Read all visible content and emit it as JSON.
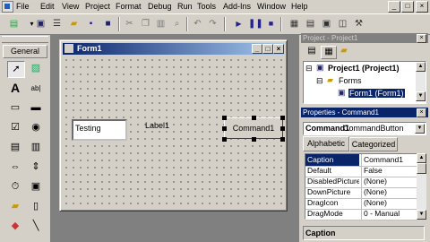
{
  "menu": {
    "items": [
      "File",
      "Edit",
      "View",
      "Project",
      "Format",
      "Debug",
      "Run",
      "Tools",
      "Add-Ins",
      "Window",
      "Help"
    ],
    "window_controls": [
      "_",
      "□",
      "×"
    ]
  },
  "toolbar": {
    "icons": [
      "add-project-icon",
      "add-form-icon",
      "menu-editor-icon",
      "open-icon",
      "save-icon",
      "cut-icon",
      "copy-icon",
      "paste-icon",
      "find-icon",
      "undo-icon",
      "redo-icon",
      "start-icon",
      "break-icon",
      "end-icon",
      "project-explorer-icon",
      "properties-window-icon",
      "form-layout-icon",
      "object-browser-icon",
      "toolbox-icon"
    ]
  },
  "toolbox": {
    "tab_label": "General",
    "tools": [
      "pointer",
      "picturebox",
      "label",
      "textbox",
      "frame",
      "commandbutton",
      "checkbox",
      "optionbutton",
      "combobox",
      "listbox",
      "hscrollbar",
      "vscrollbar",
      "timer",
      "drivelistbox",
      "dirlistbox",
      "filelistbox",
      "shape",
      "line"
    ]
  },
  "form": {
    "title": "Form1",
    "textbox_value": "Testing",
    "label_caption": "Label1",
    "button_caption": "Command1"
  },
  "project_panel": {
    "title": "Project - Project1",
    "root": "Project1 (Project1)",
    "folder": "Forms",
    "form_node": "Form1 (Form1)"
  },
  "properties_panel": {
    "title": "Properties - Command1",
    "object_name": "Command1",
    "object_type": "CommandButton",
    "tabs": [
      "Alphabetic",
      "Categorized"
    ],
    "rows": [
      {
        "name": "Caption",
        "value": "Command1"
      },
      {
        "name": "Default",
        "value": "False"
      },
      {
        "name": "DisabledPicture",
        "value": "(None)"
      },
      {
        "name": "DownPicture",
        "value": "(None)"
      },
      {
        "name": "DragIcon",
        "value": "(None)"
      },
      {
        "name": "DragMode",
        "value": "0 - Manual"
      }
    ],
    "description_title": "Caption"
  },
  "colors": {
    "active_title": "#0a246a",
    "face": "#d4d0c8",
    "workspace": "#808080"
  }
}
